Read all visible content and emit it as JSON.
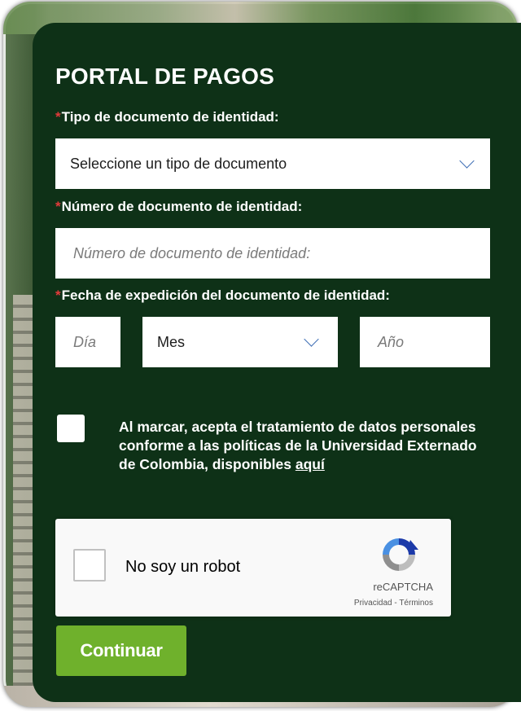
{
  "form": {
    "title": "PORTAL DE PAGOS",
    "required_mark": "*",
    "doc_type": {
      "label": "Tipo de documento de identidad:",
      "selected": "Seleccione un tipo de documento"
    },
    "doc_number": {
      "label": "Número de documento de identidad:",
      "placeholder": "Número de documento de identidad:"
    },
    "issue_date": {
      "label": "Fecha de expedición del documento de identidad:",
      "day_placeholder": "Día",
      "month_selected": "Mes",
      "year_placeholder": "Año"
    },
    "consent": {
      "text": "Al marcar, acepta el tratamiento de datos personales conforme a las políticas de la Universidad Externado de Colombia, disponibles",
      "link": "aquí",
      "checked": false
    },
    "recaptcha": {
      "label": "No soy un robot",
      "brand": "reCAPTCHA",
      "links": "Privacidad - Términos",
      "checked": false
    },
    "submit_label": "Continuar"
  },
  "colors": {
    "panel": "#0e3117",
    "required": "#e23a3a",
    "button": "#6fb12c",
    "chevron": "#3f6fb5"
  },
  "icons": [
    "chevron-down-icon",
    "recaptcha-logo-icon"
  ]
}
